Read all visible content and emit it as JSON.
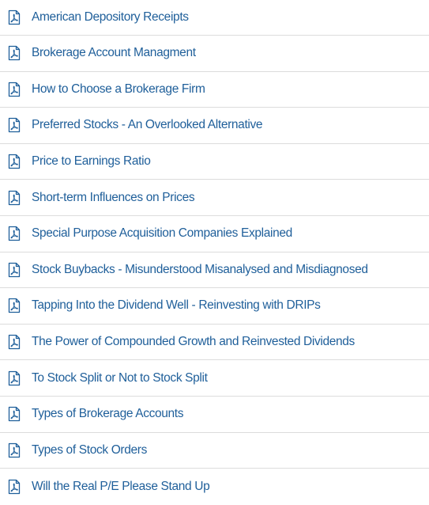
{
  "documents": {
    "icon": "pdf-file-icon",
    "link_color": "#1f5f9a",
    "items": [
      {
        "title": "American Depository Receipts"
      },
      {
        "title": "Brokerage Account Managment"
      },
      {
        "title": "How to Choose a Brokerage Firm"
      },
      {
        "title": "Preferred Stocks - An Overlooked Alternative"
      },
      {
        "title": "Price to Earnings Ratio"
      },
      {
        "title": "Short-term Influences on Prices"
      },
      {
        "title": "Special Purpose Acquisition Companies Explained"
      },
      {
        "title": "Stock Buybacks - Misunderstood Misanalysed and Misdiagnosed"
      },
      {
        "title": "Tapping Into the Dividend Well - Reinvesting with DRIPs"
      },
      {
        "title": "The Power of Compounded Growth and Reinvested Dividends"
      },
      {
        "title": "To Stock Split or Not to Stock Split"
      },
      {
        "title": "Types of Brokerage Accounts"
      },
      {
        "title": "Types of Stock Orders"
      },
      {
        "title": "Will the Real P/E Please Stand Up"
      }
    ]
  }
}
